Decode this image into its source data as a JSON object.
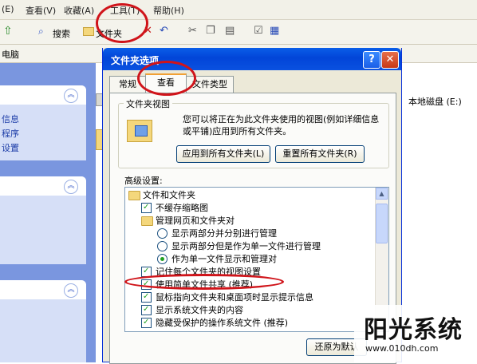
{
  "menubar": {
    "items": [
      {
        "label": "(E)"
      },
      {
        "label": "查看(V)"
      },
      {
        "label": "收藏(A)"
      },
      {
        "label": "工具(T)"
      },
      {
        "label": "帮助(H)"
      }
    ]
  },
  "toolbar": {
    "search_label": "搜索",
    "folders_label": "文件夹"
  },
  "addressbar": {
    "text": "电脑"
  },
  "leftpane": {
    "panel1_links": [
      "信息",
      "程序",
      "设置"
    ]
  },
  "mainpane": {
    "drive_label": "本地磁盘 (E:)"
  },
  "dialog": {
    "title": "文件夹选项",
    "help_glyph": "?",
    "close_glyph": "✕",
    "tabs": [
      "常规",
      "查看",
      "文件类型"
    ],
    "folder_views_title": "文件夹视图",
    "folder_views_desc": "您可以将正在为此文件夹使用的视图(例如详细信息或平铺)应用到所有文件夹。",
    "apply_all_button": "应用到所有文件夹(L)",
    "reset_all_button": "重置所有文件夹(R)",
    "advanced_label": "高级设置:",
    "tree": [
      {
        "kind": "folder",
        "text": "文件和文件夹"
      },
      {
        "kind": "checkbox",
        "checked": true,
        "text": "不缓存缩略图"
      },
      {
        "kind": "folder",
        "text": "管理网页和文件夹对"
      },
      {
        "kind": "radio",
        "checked": false,
        "text": "显示两部分并分别进行管理"
      },
      {
        "kind": "radio",
        "checked": false,
        "text": "显示两部分但是作为单一文件进行管理"
      },
      {
        "kind": "radio",
        "checked": true,
        "text": "作为单一文件显示和管理对"
      },
      {
        "kind": "checkbox",
        "checked": true,
        "text": "记住每个文件夹的视图设置"
      },
      {
        "kind": "checkbox",
        "checked": true,
        "text": "使用简单文件共享 (推荐)"
      },
      {
        "kind": "checkbox",
        "checked": true,
        "text": "鼠标指向文件夹和桌面项时显示提示信息"
      },
      {
        "kind": "checkbox",
        "checked": true,
        "text": "显示系统文件夹的内容"
      },
      {
        "kind": "checkbox",
        "checked": true,
        "text": "隐藏受保护的操作系统文件 (推荐)"
      }
    ],
    "restore_button": "还原为默认"
  },
  "watermark": {
    "title": "阳光系统",
    "url": "www.010dh.com"
  },
  "colors": {
    "annotation": "#d0141a",
    "titlebar": "#0a5ee8",
    "taskpane": "#7a96df"
  }
}
